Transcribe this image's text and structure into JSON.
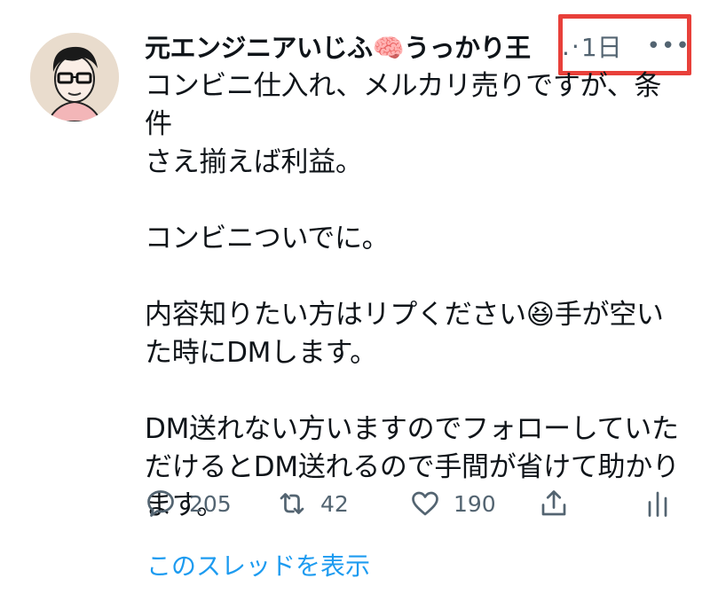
{
  "tweet": {
    "author_name": "元エンジニアいじふ🧠うっかり王",
    "ellipsis": ".",
    "separator": "·",
    "time": "1日",
    "more_label": "•••",
    "text": "コンビニ仕入れ、メルカリ売りですが、条件\nさえ揃えば利益。\n\nコンビニついでに。\n\n内容知りたい方はリプください😆手が空い\nた時にDMします。\n\nDM送れない方いますのでフォローしていた\nだけるとDM送れるので手間が省けて助かり\nます。"
  },
  "actions": {
    "reply_count": "205",
    "retweet_count": "42",
    "like_count": "190"
  },
  "thread_link": "このスレッドを表示",
  "icons": [
    "avatar",
    "reply-icon",
    "retweet-icon",
    "like-icon",
    "share-icon",
    "analytics-icon"
  ],
  "colors": {
    "link": "#1d9bf0",
    "muted": "#536471",
    "highlight": "#e8403a"
  }
}
